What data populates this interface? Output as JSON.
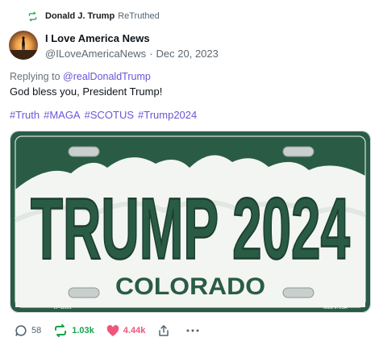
{
  "retruth": {
    "user": "Donald J. Trump",
    "label": "ReTruthed",
    "icon": "retruth-icon",
    "color": "#17a34a"
  },
  "author": {
    "name": "I Love America News",
    "handle": "@ILoveAmericaNews",
    "separator": "·",
    "date": "Dec 20, 2023",
    "avatar_icon": "avatar-sunset-silhouette"
  },
  "replying": {
    "prefix": "Replying to ",
    "target": "@realDonaldTrump"
  },
  "post": {
    "text": "God bless you, President Trump!",
    "hashtags": [
      "#Truth",
      "#MAGA",
      "#SCOTUS",
      "#Trump2024"
    ],
    "accent": "#6b56d6"
  },
  "media": {
    "plate_text": "TRUMP 2024",
    "state": "COLORADO",
    "code_left": "LP-12221",
    "code_right": "Made in USA",
    "plate_color": "#2a5c45"
  },
  "actions": {
    "replies": "58",
    "retruths": "1.03k",
    "likes": "4.44k"
  }
}
